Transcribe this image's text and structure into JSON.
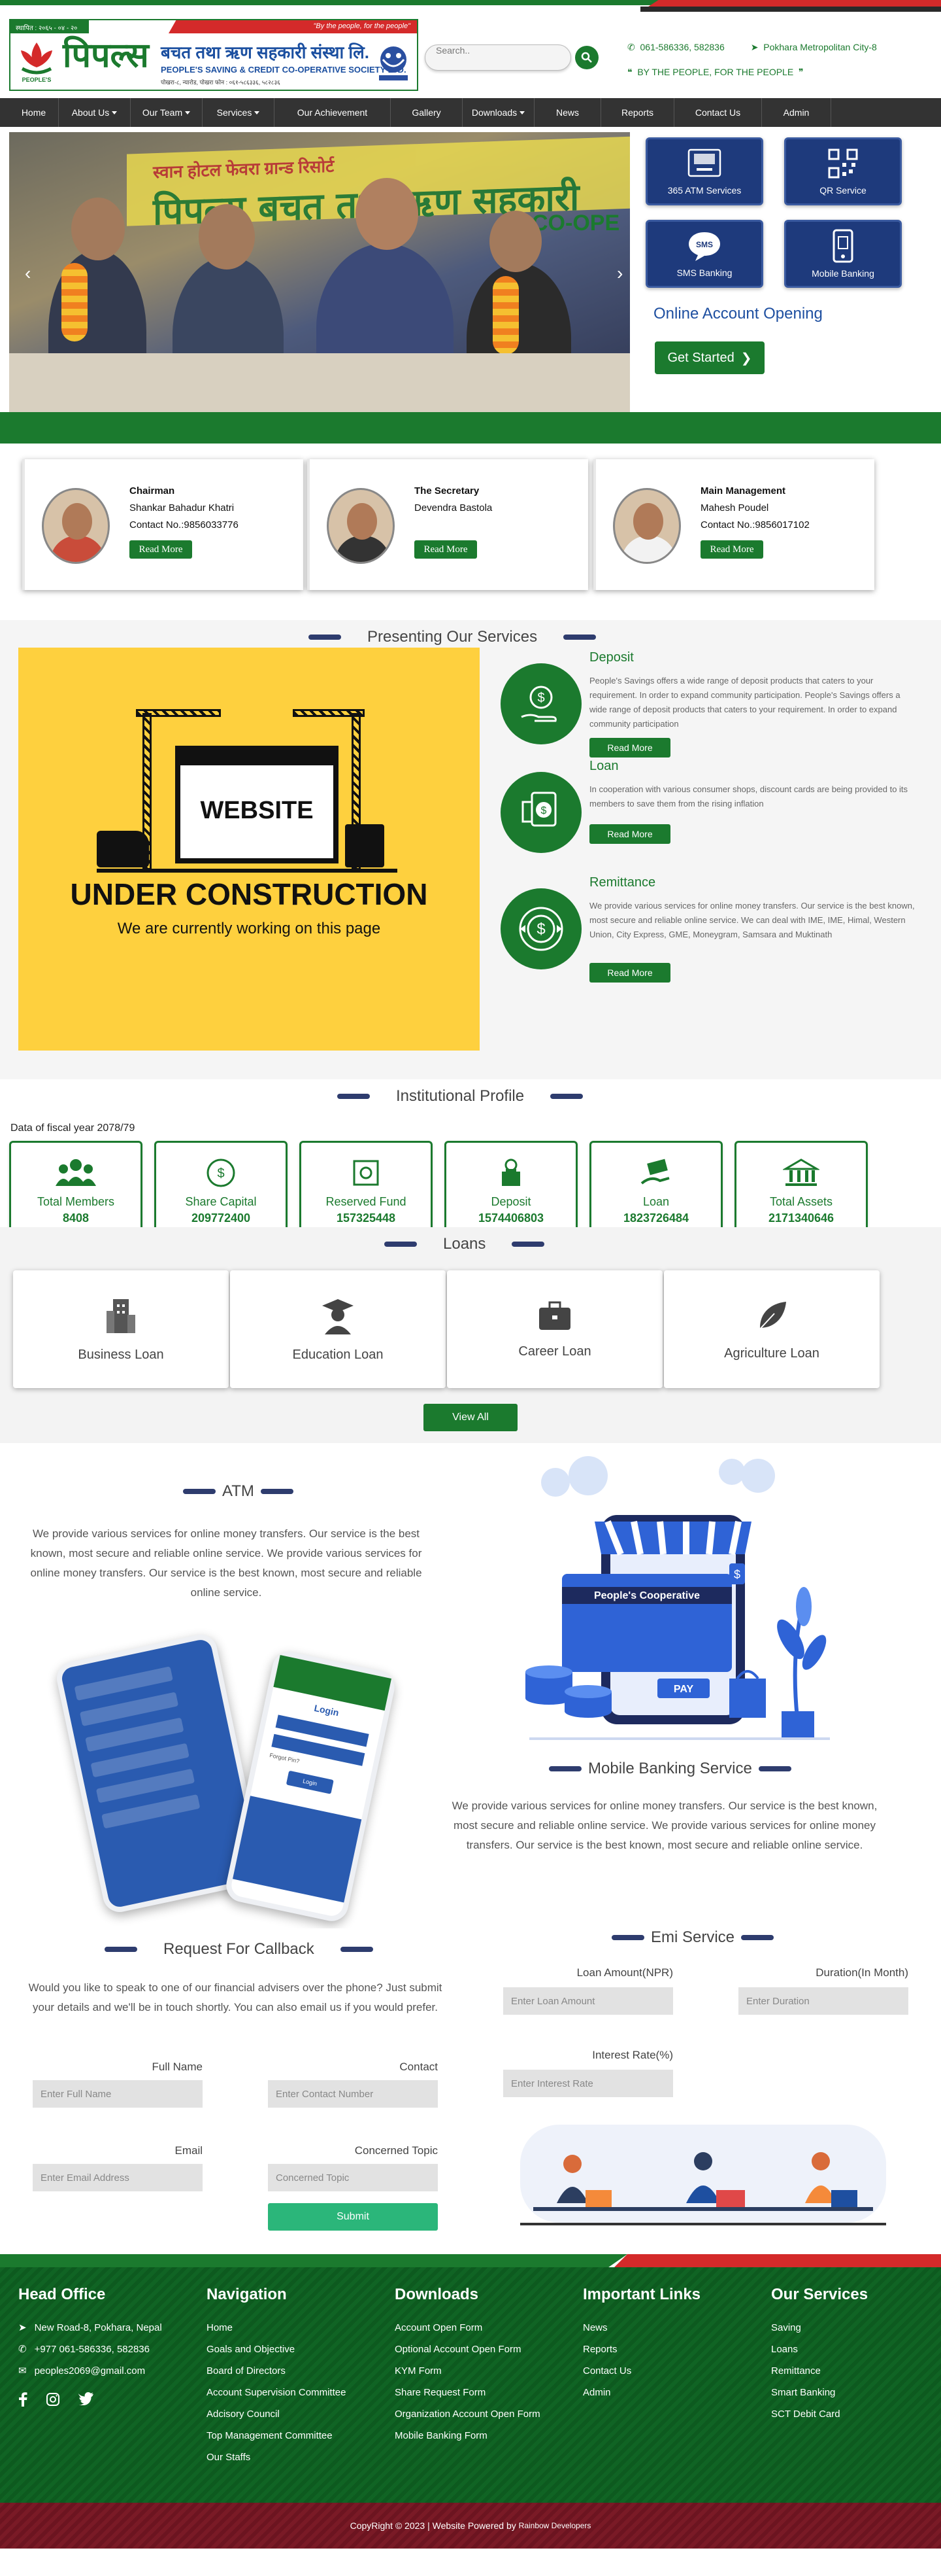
{
  "header": {
    "ribbon_left": "स्थापित : २०६५ - ०४ - २०",
    "tagline": "\"By the people, for the people\"",
    "logo_main": "पिपल्स",
    "logo_nepali": "बचत तथा ऋण सहकारी संस्था लि.",
    "logo_english": "PEOPLE'S SAVING & CREDIT CO-OPERATIVE SOCIETY LTD.",
    "logo_address": "पोखरा-८, न्यारोड, पोखरा फोन : ०६१-५८६३३६, ५८२८३६",
    "logo_mark_text": "PEOPLE'S",
    "search_placeholder": "Search..",
    "phone": "061-586336, 582836",
    "location": "Pokhara Metropolitan City-8",
    "motto": "BY THE PEOPLE, FOR THE PEOPLE"
  },
  "nav": [
    {
      "label": "Home",
      "dropdown": false
    },
    {
      "label": "About Us",
      "dropdown": true
    },
    {
      "label": "Our Team",
      "dropdown": true
    },
    {
      "label": "Services",
      "dropdown": true
    },
    {
      "label": "Our Achievement",
      "dropdown": false
    },
    {
      "label": "Gallery",
      "dropdown": false
    },
    {
      "label": "Downloads",
      "dropdown": true
    },
    {
      "label": "News",
      "dropdown": false
    },
    {
      "label": "Reports",
      "dropdown": false
    },
    {
      "label": "Contact Us",
      "dropdown": false
    },
    {
      "label": "Admin",
      "dropdown": false
    }
  ],
  "hero": {
    "banner_top": "स्वान होटल फेवरा ग्रान्ड रिसोर्ट",
    "banner_main": "पिपल्स बचत तथा ऋण सहकारी",
    "banner_english": "CO-OPE",
    "quick_links": [
      "365 ATM Services",
      "QR Service",
      "SMS Banking",
      "Mobile Banking"
    ],
    "online_title": "Online Account Opening",
    "get_started": "Get Started"
  },
  "management": [
    {
      "role": "Chairman",
      "name": "Shankar Bahadur Khatri",
      "contact": "Contact No.:9856033776",
      "button": "Read More"
    },
    {
      "role": "The Secretary",
      "name": "Devendra Bastola",
      "contact": "",
      "button": "Read More"
    },
    {
      "role": "Main Management",
      "name": "Mahesh Poudel",
      "contact": "Contact No.:9856017102",
      "button": "Read More"
    }
  ],
  "services": {
    "title": "Presenting Our Services",
    "construction": {
      "word": "WEBSITE",
      "title": "UNDER CONSTRUCTION",
      "subtitle": "We are currently working on this page"
    },
    "items": [
      {
        "title": "Deposit",
        "text": "People's Savings offers a wide range of deposit products that caters to your requirement. In order to expand community participation. People's Savings offers a wide range of deposit products that caters to your requirement. In order to expand community participation",
        "button": "Read More"
      },
      {
        "title": "Loan",
        "text": "In cooperation with various consumer shops, discount cards are being provided to its members to save them from the rising inflation",
        "button": "Read More"
      },
      {
        "title": "Remittance",
        "text": "We provide various services for online money transfers. Our service is the best known, most secure and reliable online service. We can deal with IME, IME, Himal, Western Union, City Express, GME, Moneygram, Samsara and Muktinath",
        "button": "Read More"
      }
    ]
  },
  "profile": {
    "title": "Institutional Profile",
    "fiscal_year": "Data of fiscal year 2078/79",
    "stats": [
      {
        "label": "Total Members",
        "value": "8408",
        "icon": "people-icon"
      },
      {
        "label": "Share Capital",
        "value": "209772400",
        "icon": "coin-icon"
      },
      {
        "label": "Reserved Fund",
        "value": "157325448",
        "icon": "safe-icon"
      },
      {
        "label": "Deposit",
        "value": "1574406803",
        "icon": "deposit-icon"
      },
      {
        "label": "Loan",
        "value": "1823726484",
        "icon": "hand-money-icon"
      },
      {
        "label": "Total Assets",
        "value": "2171340646",
        "icon": "bank-icon"
      }
    ]
  },
  "loans": {
    "title": "Loans",
    "items": [
      "Business Loan",
      "Education Loan",
      "Career Loan",
      "Agriculture Loan"
    ],
    "view_all": "View All"
  },
  "atm": {
    "title": "ATM",
    "text": "We provide various services for online money transfers. Our service is the best known, most secure and reliable online service. We provide various services for online money transfers. Our service is the best known, most secure and reliable online service.",
    "phone_login": "Login",
    "phone_login_btn": "Login",
    "phone_forgot": "Forgot Pin?",
    "store_sign": "People's Cooperative",
    "pay_label": "PAY",
    "mobile_title": "Mobile Banking Service",
    "mobile_text": "We provide various services for online money transfers. Our service is the best known, most secure and reliable online service. We provide various services for online money transfers. Our service is the best known, most secure and reliable online service."
  },
  "callback": {
    "title": "Request For Callback",
    "intro": "Would you like to speak to one of our financial advisers over the phone? Just submit your details and we'll be in touch shortly. You can also email us if you would prefer.",
    "full_name_label": "Full Name",
    "full_name_placeholder": "Enter Full Name",
    "contact_label": "Contact",
    "contact_placeholder": "Enter Contact Number",
    "email_label": "Email",
    "email_placeholder": "Enter Email Address",
    "topic_label": "Concerned Topic",
    "topic_placeholder": "Concerned Topic",
    "submit": "Submit"
  },
  "emi": {
    "title": "Emi Service",
    "amount_label": "Loan Amount(NPR)",
    "amount_placeholder": "Enter Loan Amount",
    "duration_label": "Duration(In Month)",
    "duration_placeholder": "Enter Duration",
    "rate_label": "Interest Rate(%)",
    "rate_placeholder": "Enter Interest Rate"
  },
  "footer": {
    "head_office": {
      "title": "Head Office",
      "address": "New Road-8, Pokhara, Nepal",
      "phone": "+977 061-586336, 582836",
      "email": "peoples2069@gmail.com"
    },
    "navigation": {
      "title": "Navigation",
      "items": [
        "Home",
        "Goals and Objective",
        "Board of Directors",
        "Account Supervision Committee",
        "Adcisory Council",
        "Top Management Committee",
        "Our Staffs"
      ]
    },
    "downloads": {
      "title": "Downloads",
      "items": [
        "Account Open Form",
        "Optional Account Open Form",
        "KYM Form",
        "Share Request Form",
        "Organization Account Open Form",
        "Mobile Banking Form"
      ]
    },
    "important": {
      "title": "Important Links",
      "items": [
        "News",
        "Reports",
        "Contact Us",
        "Admin"
      ]
    },
    "our_services": {
      "title": "Our Services",
      "items": [
        "Saving",
        "Loans",
        "Remittance",
        "Smart Banking",
        "SCT Debit Card"
      ]
    },
    "copyright": "CopyRight © 2023 | Website Powered by",
    "powered_by": "Rainbow Developers"
  },
  "colors": {
    "green": "#1b7a2e",
    "red": "#d42a2a",
    "navy": "#1e3a7c",
    "yellow": "#fed03e",
    "maroon": "#7a1a26"
  }
}
